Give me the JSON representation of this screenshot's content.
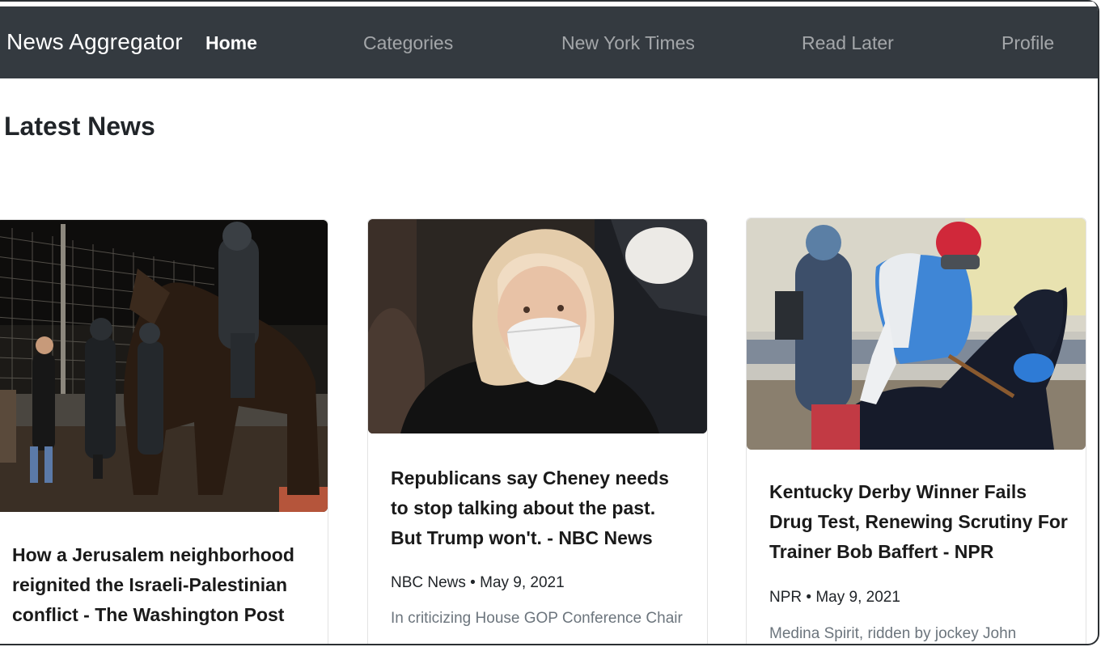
{
  "navbar": {
    "brand": "News Aggregator",
    "links": [
      {
        "label": "Home",
        "active": true
      },
      {
        "label": "Categories",
        "active": false
      },
      {
        "label": "New York Times",
        "active": false
      },
      {
        "label": "Read Later",
        "active": false
      },
      {
        "label": "Profile",
        "active": false
      }
    ]
  },
  "main": {
    "heading": "Latest News",
    "articles": [
      {
        "title": "How a Jerusalem neighborhood reignited the Israeli-Palestinian conflict - The Washington Post",
        "image_icon": "article-photo-icon"
      },
      {
        "title": "Republicans say Cheney needs to stop talking about the past. But Trump won't. - NBC News",
        "source": "NBC News",
        "date": "May 9, 2021",
        "meta": "NBC News • May 9, 2021",
        "snippet": "In criticizing House GOP Conference Chair",
        "image_icon": "article-photo-icon"
      },
      {
        "title": "Kentucky Derby Winner Fails Drug Test, Renewing Scrutiny For Trainer Bob Baffert - NPR",
        "source": "NPR",
        "date": "May 9, 2021",
        "meta": "NPR • May 9, 2021",
        "snippet": "Medina Spirit, ridden by jockey John",
        "image_icon": "article-photo-icon"
      }
    ]
  },
  "colors": {
    "navbar_bg": "#343a40",
    "nav_active": "#ffffff",
    "nav_inactive": "#9a9da0",
    "heading": "#212529",
    "snippet": "#6c757d"
  }
}
